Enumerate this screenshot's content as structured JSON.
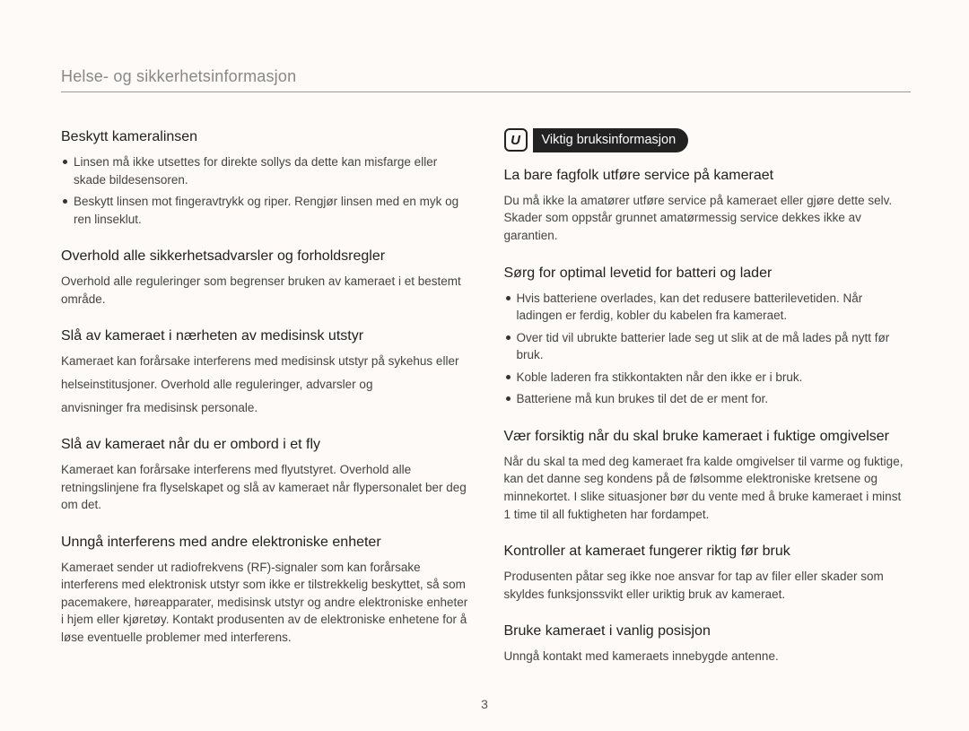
{
  "page": {
    "header": "Helse- og sikkerhetsinformasjon",
    "number": "3"
  },
  "badge": {
    "icon_glyph": "U",
    "label": "Viktig bruksinformasjon"
  },
  "left": {
    "s1": {
      "heading": "Beskytt kameralinsen",
      "b1": "Linsen må ikke utsettes for direkte sollys da dette kan misfarge eller skade bildesensoren.",
      "b2": "Beskytt linsen mot fingeravtrykk og riper. Rengjør linsen med en myk og ren linseklut."
    },
    "s2": {
      "heading": "Overhold alle sikkerhetsadvarsler og forholdsregler",
      "body": "Overhold alle reguleringer som begrenser bruken av kameraet i et bestemt område."
    },
    "s3": {
      "heading": "Slå av kameraet i nærheten av medisinsk utstyr",
      "p1": "Kameraet kan forårsake interferens med medisinsk utstyr på sykehus eller",
      "p2": "helseinstitusjoner. Overhold alle reguleringer, advarsler og",
      "p3": "anvisninger fra medisinsk personale."
    },
    "s4": {
      "heading": "Slå av kameraet når du er ombord i et fly",
      "body": "Kameraet kan forårsake interferens med flyutstyret. Overhold alle retningslinjene fra flyselskapet og slå av kameraet når flypersonalet ber deg om det."
    },
    "s5": {
      "heading": "Unngå interferens med andre elektroniske enheter",
      "body": "Kameraet sender ut radiofrekvens (RF)-signaler som kan forårsake interferens med elektronisk utstyr som ikke er tilstrekkelig beskyttet, så som pacemakere, høreapparater, medisinsk utstyr og andre elektroniske enheter i hjem eller kjøretøy. Kontakt produsenten av de elektroniske enhetene for å løse eventuelle problemer med interferens."
    }
  },
  "right": {
    "s1": {
      "heading": "La bare fagfolk utføre service på kameraet",
      "body": "Du må ikke la amatører utføre service på kameraet eller gjøre dette selv. Skader som oppstår grunnet amatørmessig service dekkes ikke av garantien."
    },
    "s2": {
      "heading": "Sørg for optimal levetid for batteri og lader",
      "b1": "Hvis batteriene overlades, kan det redusere batterilevetiden. Når ladingen er ferdig, kobler du kabelen fra kameraet.",
      "b2": "Over tid vil ubrukte batterier lade seg ut slik at de må lades på nytt før bruk.",
      "b3": "Koble laderen fra stikkontakten når den ikke er i bruk.",
      "b4": "Batteriene må kun brukes til det de er ment for."
    },
    "s3": {
      "heading": "Vær forsiktig når du skal bruke kameraet i fuktige omgivelser",
      "body": "Når du skal ta med deg kameraet fra kalde omgivelser til varme og fuktige, kan det danne seg kondens på de følsomme elektroniske kretsene og minnekortet. I slike situasjoner bør du vente med å bruke kameraet i minst 1 time til all fuktigheten har fordampet."
    },
    "s4": {
      "heading": "Kontroller at kameraet fungerer riktig før bruk",
      "body": "Produsenten påtar seg ikke noe ansvar for tap av filer eller skader som skyldes funksjonssvikt eller uriktig bruk av kameraet."
    },
    "s5": {
      "heading": "Bruke kameraet i vanlig posisjon",
      "body": "Unngå kontakt med kameraets innebygde antenne."
    }
  }
}
